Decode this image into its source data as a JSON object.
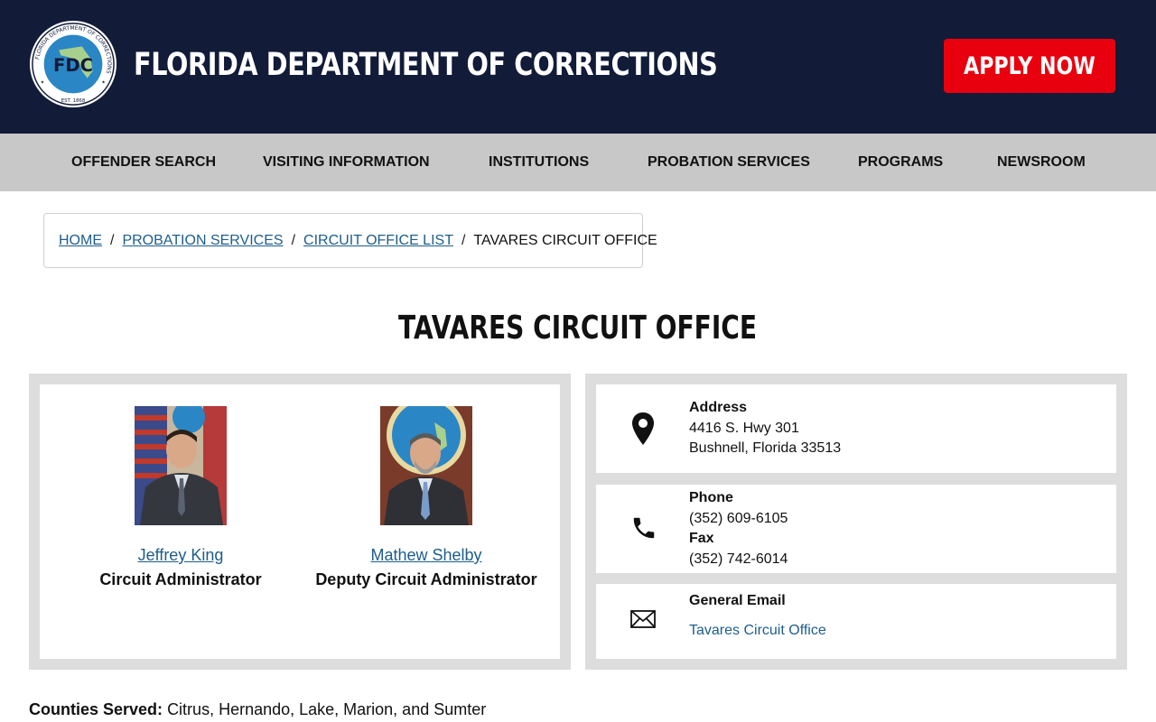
{
  "header": {
    "seal_ring_text": "FLORIDA DEPARTMENT OF CORRECTIONS",
    "seal_initials": "FDC",
    "seal_est": "EST. 1868",
    "title": "FLORIDA DEPARTMENT OF CORRECTIONS",
    "apply_label": "APPLY NOW"
  },
  "nav": {
    "items": [
      {
        "label": "OFFENDER SEARCH"
      },
      {
        "label": "VISITING INFORMATION"
      },
      {
        "label": "INSTITUTIONS"
      },
      {
        "label": "PROBATION SERVICES"
      },
      {
        "label": "PROGRAMS"
      },
      {
        "label": "NEWSROOM"
      }
    ]
  },
  "breadcrumb": {
    "items": [
      "HOME",
      "PROBATION SERVICES",
      "CIRCUIT OFFICE LIST"
    ],
    "separator": "/",
    "current": "TAVARES CIRCUIT OFFICE"
  },
  "page_title": "TAVARES CIRCUIT OFFICE",
  "staff": [
    {
      "name": "Jeffrey King",
      "role": "Circuit Administrator"
    },
    {
      "name": "Mathew Shelby",
      "role": "Deputy Circuit Administrator"
    }
  ],
  "contact": {
    "address_label": "Address",
    "address_line1": "4416 S. Hwy 301",
    "address_line2": "Bushnell, Florida 33513",
    "phone_label": "Phone",
    "phone": "(352) 609-6105",
    "fax_label": "Fax",
    "fax": "(352) 742-6014",
    "email_label": "General Email",
    "email_link": "Tavares Circuit Office"
  },
  "counties": {
    "label": "Counties Served:",
    "value": "Citrus, Hernando, Lake, Marion, and Sumter"
  },
  "colors": {
    "header_bg": "#121b38",
    "apply_bg": "#e8000e",
    "nav_bg": "#c8c8c8",
    "link": "#1d5d8c",
    "panel_bg": "#dddddd"
  }
}
